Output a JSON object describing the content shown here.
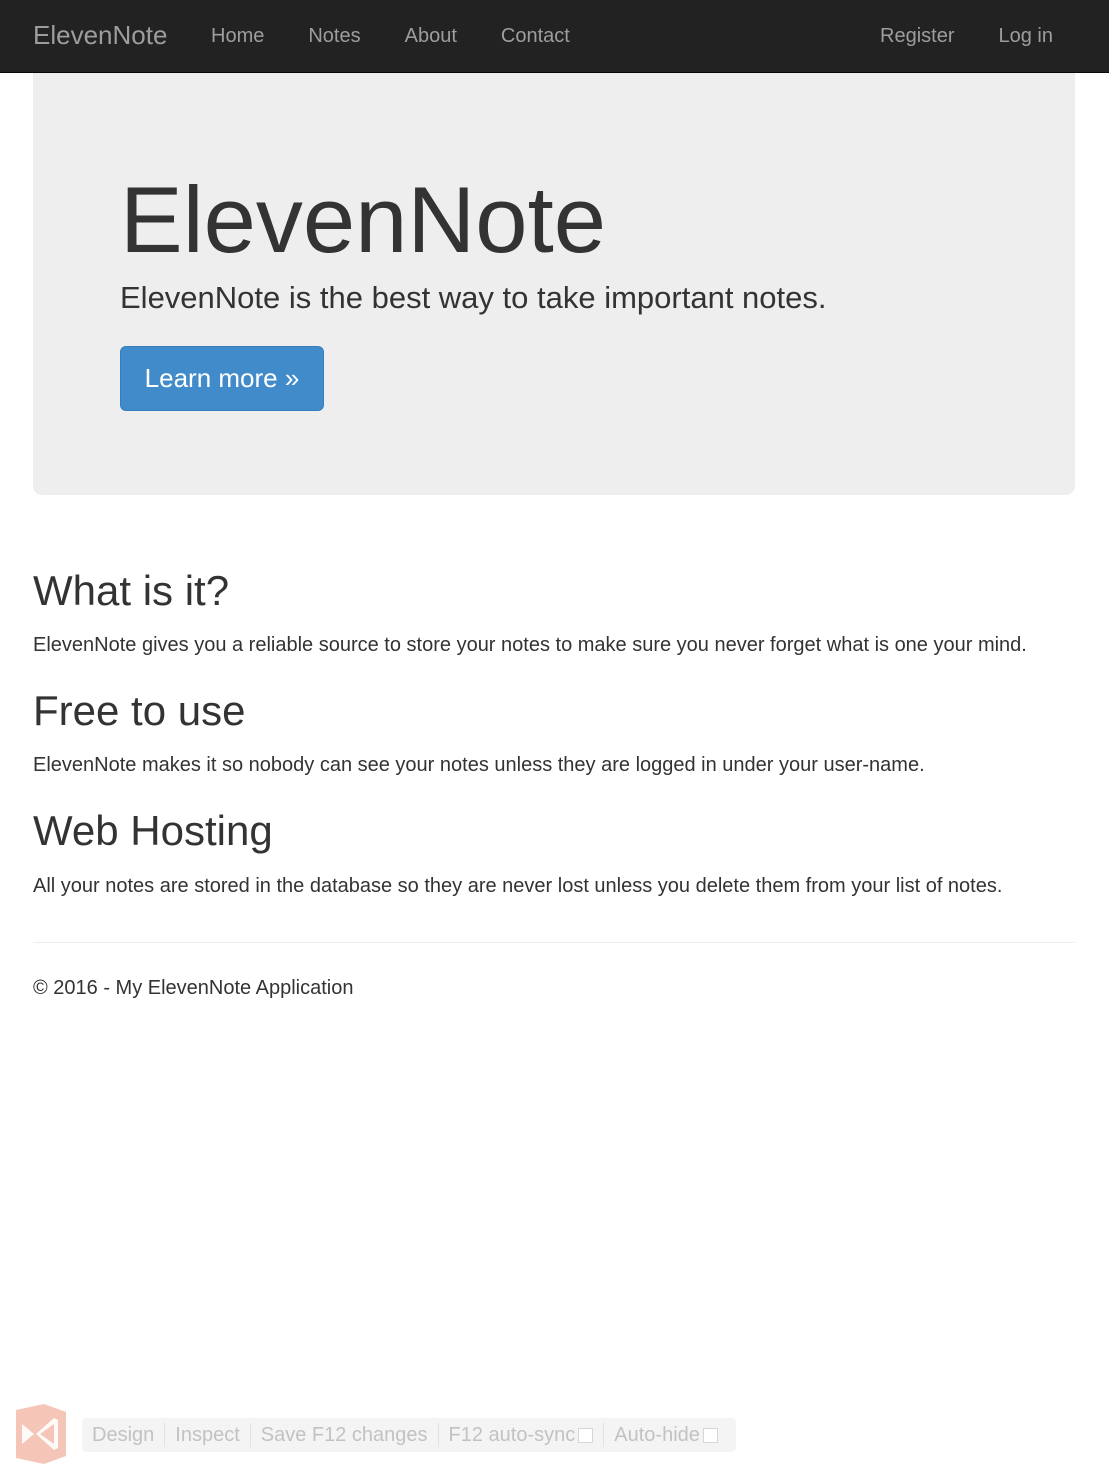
{
  "navbar": {
    "brand": "ElevenNote",
    "left_links": [
      "Home",
      "Notes",
      "About",
      "Contact"
    ],
    "right_links": [
      "Register",
      "Log in"
    ]
  },
  "jumbotron": {
    "title": "ElevenNote",
    "lead": "ElevenNote is the best way to take important notes.",
    "button_label": "Learn more »"
  },
  "sections": [
    {
      "heading": "What is it?",
      "text": "ElevenNote gives you a reliable source to store your notes to make sure you never forget what is one your mind."
    },
    {
      "heading": "Free to use",
      "text": "ElevenNote makes it so nobody can see your notes unless they are logged in under your user-name."
    },
    {
      "heading": "Web Hosting",
      "text": "All your notes are stored in the database so they are never lost unless you delete them from your list of notes."
    }
  ],
  "footer": {
    "text": "© 2016 - My ElevenNote Application"
  },
  "browser_link": {
    "icon": "visual-studio-icon",
    "items": [
      "Design",
      "Inspect",
      "Save F12 changes",
      "F12 auto-sync",
      "Auto-hide"
    ],
    "auto_sync_checked": false,
    "auto_hide_checked": false
  },
  "colors": {
    "navbar_bg": "#222222",
    "nav_text": "#9d9d9d",
    "jumbotron_bg": "#eeeeee",
    "primary_button": "#428bca",
    "text": "#333333"
  }
}
